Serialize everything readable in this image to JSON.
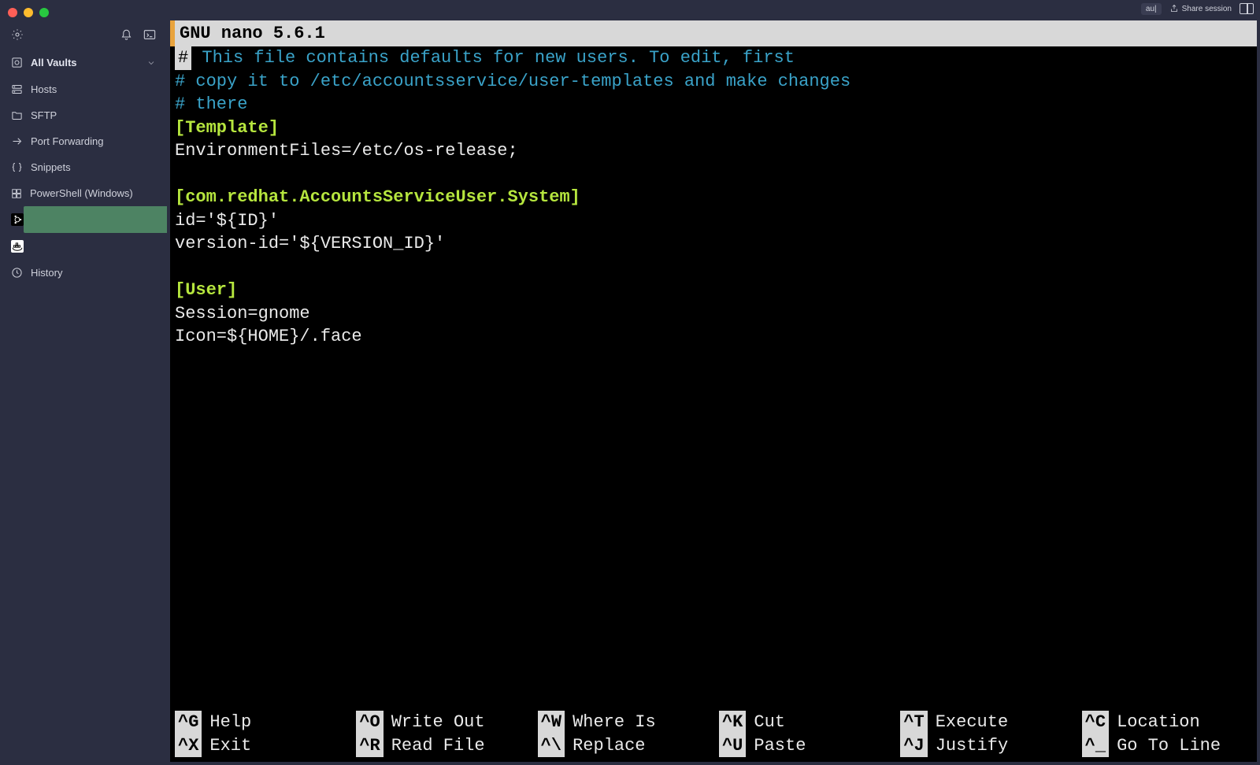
{
  "topbar": {
    "badge": "au|",
    "share_label": "Share session"
  },
  "sidebar": {
    "section_label": "All Vaults",
    "items": [
      {
        "label": "Hosts"
      },
      {
        "label": "SFTP"
      },
      {
        "label": "Port Forwarding"
      },
      {
        "label": "Snippets"
      },
      {
        "label": "PowerShell (Windows)"
      },
      {
        "label": ""
      },
      {
        "label": ""
      },
      {
        "label": "History"
      }
    ]
  },
  "nano": {
    "title": "  GNU nano 5.6.1",
    "lines": [
      {
        "t": "comment_first",
        "text": " This file contains defaults for new users. To edit, first"
      },
      {
        "t": "comment",
        "text": "# copy it to /etc/accountsservice/user-templates and make changes"
      },
      {
        "t": "comment",
        "text": "# there"
      },
      {
        "t": "section",
        "text": "[Template]"
      },
      {
        "t": "plain",
        "text": "EnvironmentFiles=/etc/os-release;"
      },
      {
        "t": "plain",
        "text": ""
      },
      {
        "t": "section",
        "text": "[com.redhat.AccountsServiceUser.System]"
      },
      {
        "t": "plain",
        "text": "id='${ID}'"
      },
      {
        "t": "plain",
        "text": "version-id='${VERSION_ID}'"
      },
      {
        "t": "plain",
        "text": ""
      },
      {
        "t": "section",
        "text": "[User]"
      },
      {
        "t": "plain",
        "text": "Session=gnome"
      },
      {
        "t": "plain",
        "text": "Icon=${HOME}/.face"
      }
    ],
    "shortcuts": [
      {
        "key": "^G",
        "desc": "Help"
      },
      {
        "key": "^O",
        "desc": "Write Out"
      },
      {
        "key": "^W",
        "desc": "Where Is"
      },
      {
        "key": "^K",
        "desc": "Cut"
      },
      {
        "key": "^T",
        "desc": "Execute"
      },
      {
        "key": "^C",
        "desc": "Location"
      },
      {
        "key": "^X",
        "desc": "Exit"
      },
      {
        "key": "^R",
        "desc": "Read File"
      },
      {
        "key": "^\\",
        "desc": "Replace"
      },
      {
        "key": "^U",
        "desc": "Paste"
      },
      {
        "key": "^J",
        "desc": "Justify"
      },
      {
        "key": "^_",
        "desc": "Go To Line"
      }
    ]
  }
}
